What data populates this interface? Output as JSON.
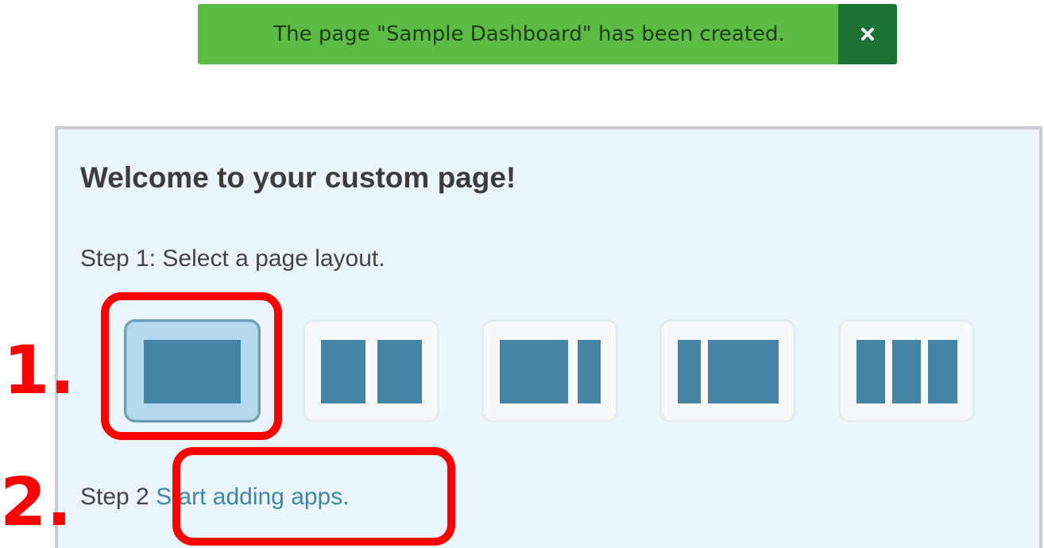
{
  "notification": {
    "message": "The page \"Sample Dashboard\" has been created.",
    "close_icon": "close-icon",
    "color": "#5bbb45",
    "close_color": "#1d7335"
  },
  "panel": {
    "title": "Welcome to your custom page!",
    "step1": "Step 1: Select a page layout.",
    "layouts": [
      {
        "name": "one-column",
        "selected": true
      },
      {
        "name": "two-equal-columns",
        "selected": false
      },
      {
        "name": "wide-left-narrow-right",
        "selected": false
      },
      {
        "name": "narrow-left-wide-right",
        "selected": false
      },
      {
        "name": "three-columns",
        "selected": false
      }
    ],
    "step2_prefix": "Step 2",
    "step2_link": "Start adding apps.",
    "accent_color": "#4584a5",
    "link_color": "#3f86ad"
  },
  "annotations": {
    "label_1": "1.",
    "label_2": "2.",
    "color": "#ff0000"
  }
}
